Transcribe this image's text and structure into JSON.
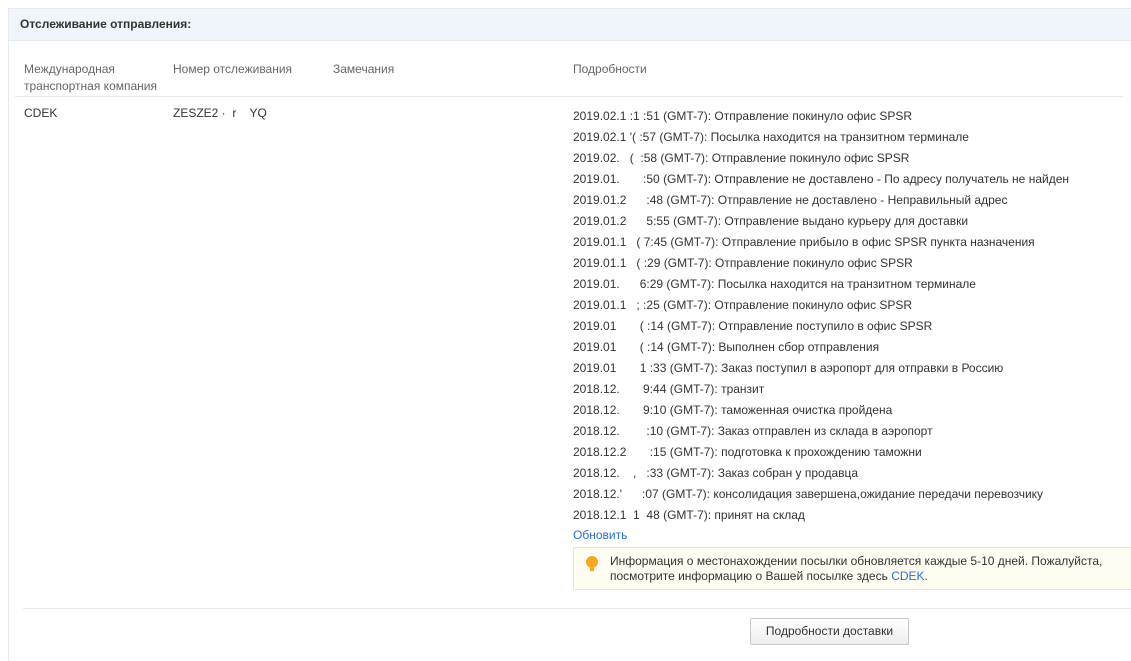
{
  "header": {
    "title": "Отслеживание отправления:"
  },
  "columns": {
    "carrier": "Международная транспортная компания",
    "tracking": "Номер отслеживания",
    "remarks": "Замечания",
    "details": "Подробности"
  },
  "row": {
    "carrier": "CDEK",
    "tracking": "ZESZE2 ·  r    YQ",
    "remarks": ""
  },
  "events": [
    "2019.02.1 :1 :51 (GMT-7): Отправление покинуло офис SPSR",
    "2019.02.1 '( :57 (GMT-7): Посылка находится на транзитном терминале",
    "2019.02.   (  :58 (GMT-7): Отправление покинуло офис SPSR",
    "2019.01.       :50 (GMT-7): Отправление не доставлено - По адресу получатель не найден",
    "2019.01.2      :48 (GMT-7): Отправление не доставлено - Неправильный адрес",
    "2019.01.2      5:55 (GMT-7): Отправление выдано курьеру для доставки",
    "2019.01.1   ( 7:45 (GMT-7): Отправление прибыло в офис SPSR пункта назначения",
    "2019.01.1   ( :29 (GMT-7): Отправление покинуло офис SPSR",
    "2019.01.      6:29 (GMT-7): Посылка находится на транзитном терминале",
    "2019.01.1   ; :25 (GMT-7): Отправление покинуло офис SPSR",
    "2019.01       ( :14 (GMT-7): Отправление поступило в офис SPSR",
    "2019.01       ( :14 (GMT-7): Выполнен сбор отправления",
    "2019.01       1 :33 (GMT-7): Заказ поступил в аэропорт для отправки в Россию",
    "2018.12.       9:44 (GMT-7): транзит",
    "2018.12.       9:10 (GMT-7): таможенная очистка пройдена",
    "2018.12.        :10 (GMT-7): Заказ отправлен из склада в аэропорт",
    "2018.12.2       :15 (GMT-7): подготовка к прохождению таможни",
    "2018.12.    ,   :33 (GMT-7): Заказ собран у продавца",
    "2018.12.'      :07 (GMT-7): консолидация завершена,ожидание передачи перевозчику",
    "2018.12.1  1  48 (GMT-7): принят на склад"
  ],
  "refresh_label": "Обновить",
  "notice": {
    "text": "Информация о местонахождении посылки обновляется каждые 5-10 дней. Пожалуйста, посмотрите информацию о Вашей посылке здесь ",
    "link": "CDEK",
    "end": "."
  },
  "button_label": "Подробности доставки",
  "colors": {
    "link": "#2a6fcf",
    "header_bg": "#f0f4fb",
    "notice_bg": "#fffdf2",
    "notice_icon": "#f5a623"
  }
}
